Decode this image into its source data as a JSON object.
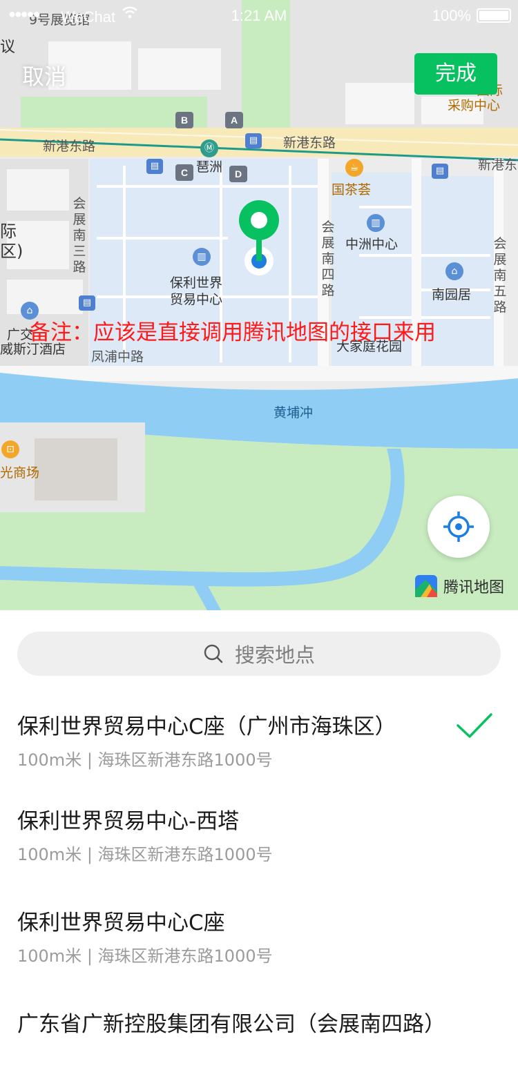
{
  "status_bar": {
    "signal": "●●●●●",
    "carrier": "WeChat",
    "time": "1:21 AM",
    "battery": "100%"
  },
  "nav": {
    "cancel_label": "取消",
    "done_label": "完成",
    "done_color": "#07c160"
  },
  "note": "备注：应该是直接调用腾讯地图的接口来用",
  "map": {
    "labels": {
      "xingang_w": "新港东路",
      "xingang_c": "新港东路",
      "xingang_e": "新港东",
      "pazhou": "琶洲",
      "guochayun": "国茶荟",
      "purchase": "采购中心",
      "purchase_top": "国际",
      "hzsan": "会展南三路",
      "hzsi": "会展南四路",
      "hzwu": "会展南五路",
      "zhongzhou": "中洲中心",
      "poly": "保利世界贸易中心",
      "nanyuan": "南园居",
      "dajiating": "大家庭花园",
      "fengpu": "凤浦中路",
      "huangpu": "黄埔冲",
      "westin": "威斯汀酒店",
      "guangjiao": "广交",
      "mall": "光商场",
      "expo": "9号展览馆",
      "left_edge_a": "际",
      "left_edge_b": "区)",
      "left_edge_c": "议"
    },
    "exits": [
      "A",
      "B",
      "C",
      "D"
    ]
  },
  "brand": {
    "name": "腾讯地图"
  },
  "search": {
    "placeholder": "搜索地点"
  },
  "results": [
    {
      "title": "保利世界贸易中心C座（广州市海珠区）",
      "subtitle": "100m米 | 海珠区新港东路1000号",
      "selected": true
    },
    {
      "title": "保利世界贸易中心-西塔",
      "subtitle": "100m米 | 海珠区新港东路1000号",
      "selected": false
    },
    {
      "title": "保利世界贸易中心C座",
      "subtitle": "100m米 | 海珠区新港东路1000号",
      "selected": false
    },
    {
      "title": "广东省广新控股集团有限公司（会展南四路）",
      "subtitle": "",
      "selected": false
    }
  ],
  "colors": {
    "accent": "#07c160",
    "pin": "#07c160",
    "locate": "#1e7ee0",
    "note": "#ff1a1a"
  }
}
